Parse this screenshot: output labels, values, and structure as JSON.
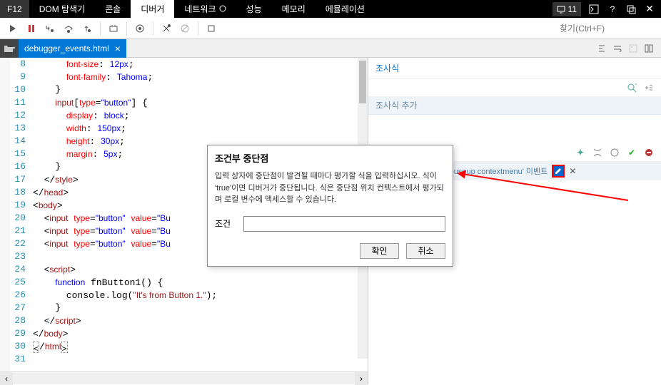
{
  "titlebar": {
    "f12": "F12",
    "tabs": [
      "DOM 탐색기",
      "콘솔",
      "디버거",
      "네트워크",
      "성능",
      "메모리",
      "에뮬레이션"
    ],
    "active_tab": 2,
    "error_count": "11"
  },
  "toolbar": {
    "search_placeholder": "찾기(Ctrl+F)"
  },
  "filebar": {
    "filename": "debugger_events.html",
    "close": "×"
  },
  "watch": {
    "header": "조사식",
    "add": "조사식 추가"
  },
  "breakpoints": {
    "row_text": "mousedown mouseup contextmenu' 이벤트",
    "checked": true
  },
  "dialog": {
    "title": "조건부 중단점",
    "message": "입력 상자에 중단점이 발견될 때마다 평가할 식을 입력하십시오. 식이 'true'이면 디버거가 중단됩니다. 식은 중단점 위치 컨텍스트에서 평가되며 로컬 변수에 액세스할 수 있습니다.",
    "condition_label": "조건",
    "condition_value": "",
    "ok": "확인",
    "cancel": "취소"
  },
  "code": {
    "lines": [
      {
        "n": 8,
        "html": "      <span class='prop'>font-size</span>: <span class='css-val'>12px</span>;"
      },
      {
        "n": 9,
        "html": "      <span class='prop'>font-family</span>: <span class='css-val'>Tahoma</span>;"
      },
      {
        "n": 10,
        "html": "    }"
      },
      {
        "n": 11,
        "html": "    <span class='tag'>input</span>[<span class='attr'>type</span>=<span class='val'>\"button\"</span>] {"
      },
      {
        "n": 12,
        "html": "      <span class='prop'>display</span>: <span class='css-val'>block</span>;"
      },
      {
        "n": 13,
        "html": "      <span class='prop'>width</span>: <span class='css-val'>150px</span>;"
      },
      {
        "n": 14,
        "html": "      <span class='prop'>height</span>: <span class='css-val'>30px</span>;"
      },
      {
        "n": 15,
        "html": "      <span class='prop'>margin</span>: <span class='css-val'>5px</span>;"
      },
      {
        "n": 16,
        "html": "    }"
      },
      {
        "n": 17,
        "html": "  &lt;/<span class='tag'>style</span>&gt;"
      },
      {
        "n": 18,
        "html": "&lt;/<span class='tag'>head</span>&gt;"
      },
      {
        "n": 19,
        "html": "&lt;<span class='tag'>body</span>&gt;"
      },
      {
        "n": 20,
        "html": "  &lt;<span class='tag'>input</span> <span class='attr'>type</span>=<span class='val'>\"button\"</span> <span class='attr'>value</span>=<span class='val'>\"Bu</span>"
      },
      {
        "n": 21,
        "html": "  &lt;<span class='tag'>input</span> <span class='attr'>type</span>=<span class='val'>\"button\"</span> <span class='attr'>value</span>=<span class='val'>\"Bu</span>"
      },
      {
        "n": 22,
        "html": "  &lt;<span class='tag'>input</span> <span class='attr'>type</span>=<span class='val'>\"button\"</span> <span class='attr'>value</span>=<span class='val'>\"Bu</span>"
      },
      {
        "n": 23,
        "html": ""
      },
      {
        "n": 24,
        "html": "  &lt;<span class='tag'>script</span>&gt;"
      },
      {
        "n": 25,
        "html": "    <span class='kw'>function</span> fnButton1() {"
      },
      {
        "n": 26,
        "html": "      console.log(<span class='str'>\"It's from Button 1.\"</span>);"
      },
      {
        "n": 27,
        "html": "    }"
      },
      {
        "n": 28,
        "html": "  &lt;/<span class='tag'>script</span>&gt;"
      },
      {
        "n": 29,
        "html": "&lt;/<span class='tag'>body</span>&gt;"
      },
      {
        "n": 30,
        "html": "<span class='cursor-box'>&lt;</span>/<span class='tag'>html</span><span class='cursor-box'>&gt;</span>"
      },
      {
        "n": 31,
        "html": ""
      }
    ]
  }
}
